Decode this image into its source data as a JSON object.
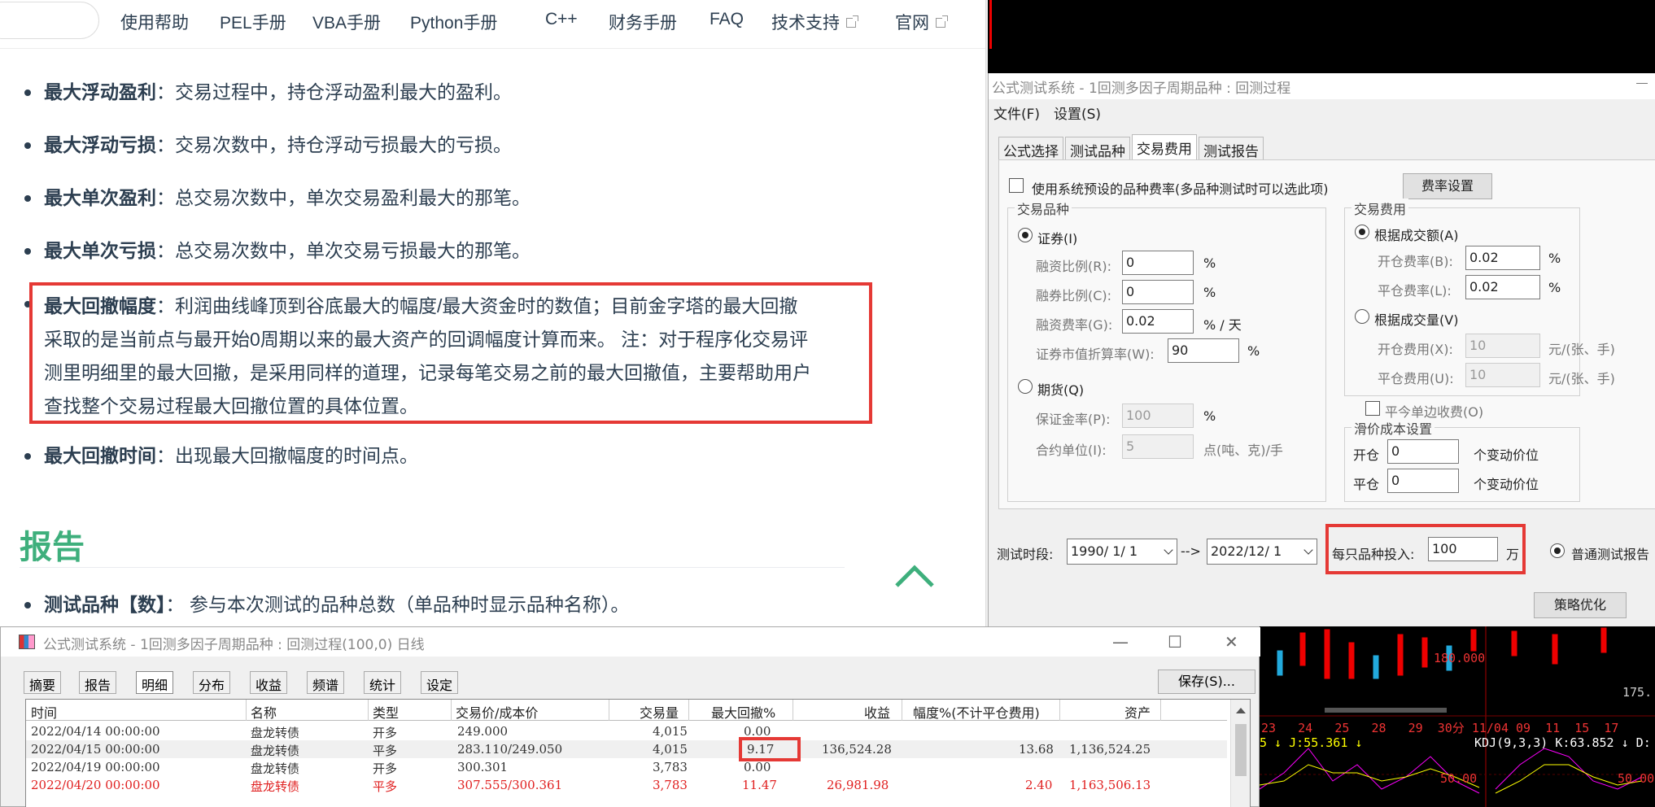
{
  "help_page": {
    "nav": [
      "使用帮助",
      "PEL手册",
      "VBA手册",
      "Python手册",
      "C++",
      "财务手册",
      "FAQ",
      "技术支持",
      "官网"
    ],
    "items": [
      {
        "term": "最大浮动盈利",
        "desc": "：交易过程中，持仓浮动盈利最大的盈利。"
      },
      {
        "term": "最大浮动亏损",
        "desc": "：交易次数中，持仓浮动亏损最大的亏损。"
      },
      {
        "term": "最大单次盈利",
        "desc": "：总交易次数中，单次交易盈利最大的那笔。"
      },
      {
        "term": "最大单次亏损",
        "desc": "：总交易次数中，单次交易亏损最大的那笔。"
      }
    ],
    "highlight": {
      "term": "最大回撤幅度",
      "line1": "：利润曲线峰顶到谷底最大的幅度/最大资金时的数值；目前金字塔的最大回撤",
      "line2": "采取的是当前点与最开始0周期以来的最大资产的回调幅度计算而来。 注：对于程序化交易评",
      "line3": "测里明细里的最大回撤，是采用同样的道理，记录每笔交易之前的最大回撤值，主要帮助用户",
      "line4": "查找整个交易过程最大回撤位置的具体位置。"
    },
    "item_after": {
      "term": "最大回撤时间",
      "desc": "：出现最大回撤幅度的时间点。"
    },
    "section_title": "报告",
    "report_item": {
      "term": "测试品种【数】",
      "desc": "： 参与本次测试的品种总数（单品种时显示品种名称）。"
    }
  },
  "dialog": {
    "title": "公式测试系统 - 1回测多因子周期品种 : 回测过程",
    "menu": [
      "文件(F)",
      "设置(S)"
    ],
    "tabs": [
      "公式选择",
      "测试品种",
      "交易费用",
      "测试报告"
    ],
    "use_system_fee": "使用系统预设的品种费率(多品种测试时可以选此项)",
    "fee_settings_btn": "费率设置",
    "group_variety": "交易品种",
    "group_fee": "交易费用",
    "securities": "证券(I)",
    "margin_ratio_label": "融资比例(R):",
    "margin_ratio": "0",
    "short_ratio_label": "融券比例(C):",
    "short_ratio": "0",
    "margin_rate_label": "融资费率(G):",
    "margin_rate": "0.02",
    "pct": "%",
    "pct_day": "% / 天",
    "discount_label": "证券市值折算率(W):",
    "discount": "90",
    "futures": "期货(Q)",
    "deposit_label": "保证金率(P):",
    "deposit": "100",
    "contract_label": "合约单位(I):",
    "contract": "5",
    "contract_unit": "点(吨、克)/手",
    "by_amount": "根据成交额(A)",
    "open_rate_label": "开仓费率(B):",
    "open_rate": "0.02",
    "close_rate_label": "平仓费率(L):",
    "close_rate": "0.02",
    "by_volume": "根据成交量(V)",
    "open_fee_label": "开仓费用(X):",
    "open_fee": "10",
    "close_fee_label": "平仓费用(U):",
    "close_fee": "10",
    "fee_unit": "元/(张、手)",
    "close_today_single": "平今单边收费(O)",
    "slippage_group": "滑价成本设置",
    "slip_open_label": "开仓",
    "slip_open": "0",
    "slip_close_label": "平仓",
    "slip_close": "0",
    "slip_unit": "个变动价位",
    "period_label": "测试时段:",
    "start_date": "1990/ 1/ 1",
    "arrow": "-->",
    "end_date": "2022/12/ 1",
    "invest_label": "每只品种投入:",
    "invest": "100",
    "invest_unit": "万",
    "normal_test": "普通测试报告",
    "optimize_btn": "策略优化"
  },
  "backtest": {
    "title": "公式测试系统 - 1回测多因子周期品种 : 回测过程(100,0) 日线",
    "toolbar": [
      "摘要",
      "报告",
      "明细",
      "分布",
      "收益",
      "频谱",
      "统计",
      "设定"
    ],
    "save_btn": "保存(S)...",
    "columns": [
      "时间",
      "名称",
      "类型",
      "交易价/成本价",
      "交易量",
      "最大回撤%",
      "收益",
      "幅度%(不计平仓费用)",
      "资产"
    ],
    "rows": [
      {
        "time": "2022/04/14 00:00:00",
        "name": "盘龙转债",
        "type": "开多",
        "price": "249.000",
        "volume": "4,015",
        "drawdown": "0.00",
        "profit": "",
        "pct": "",
        "asset": ""
      },
      {
        "time": "2022/04/15 00:00:00",
        "name": "盘龙转债",
        "type": "平多",
        "price": "283.110/249.050",
        "volume": "4,015",
        "drawdown": "9.17",
        "profit": "136,524.28",
        "pct": "13.68",
        "asset": "1,136,524.25"
      },
      {
        "time": "2022/04/19 00:00:00",
        "name": "盘龙转债",
        "type": "开多",
        "price": "300.301",
        "volume": "3,783",
        "drawdown": "0.00",
        "profit": "",
        "pct": "",
        "asset": ""
      },
      {
        "time": "2022/04/20 00:00:00",
        "name": "盘龙转债",
        "type": "平多",
        "price": "307.555/300.361",
        "volume": "3,783",
        "drawdown": "11.47",
        "profit": "26,981.98",
        "pct": "2.40",
        "asset": "1,163,506.13"
      }
    ]
  },
  "chart": {
    "price_label": "180.000",
    "price_label2": "175.",
    "dates": [
      "23",
      "24",
      "25",
      "28",
      "29",
      "30分",
      "11/04",
      "09",
      "11",
      "15",
      "17"
    ],
    "j_label": "5 ↓ J:55.361 ↓",
    "kdj_label": "KDJ(9,3,3)  K:63.852 ↓ D:",
    "level_50": "50.00",
    "level_50b": "50.00"
  }
}
